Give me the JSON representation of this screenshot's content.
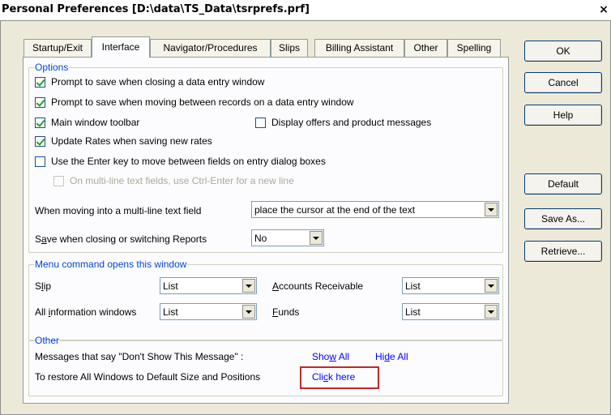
{
  "window": {
    "title": "Personal Preferences [D:\\data\\TS_Data\\tsrprefs.prf]",
    "close_label": "×"
  },
  "tabs": [
    {
      "label": "Startup/Exit",
      "active": false
    },
    {
      "label": "Interface",
      "active": true
    },
    {
      "label": "Navigator/Procedures",
      "active": false
    },
    {
      "label": "Slips",
      "active": false
    },
    {
      "label": "Billing Assistant",
      "active": false
    },
    {
      "label": "Other",
      "active": false
    },
    {
      "label": "Spelling",
      "active": false
    }
  ],
  "options": {
    "legend": "Options",
    "prompt_close": {
      "label": "Prompt to save when closing a data entry window",
      "checked": true
    },
    "prompt_move": {
      "label": "Prompt to save when moving between records on a data entry window",
      "checked": true
    },
    "main_toolbar": {
      "label": "Main window toolbar",
      "checked": true
    },
    "display_offers": {
      "label": "Display offers and product messages",
      "checked": false
    },
    "update_rates": {
      "label": "Update Rates when saving new rates",
      "checked": true
    },
    "enter_key": {
      "label": "Use the Enter key to move between fields on entry dialog boxes",
      "checked": false
    },
    "ctrl_enter": {
      "label": "On multi-line text fields, use Ctrl-Enter for a new line",
      "checked": false,
      "disabled": true
    },
    "multiline_label": "When moving into a multi-line text field",
    "multiline_value": "place the cursor at the end of the text",
    "save_switch_label_pre": "S",
    "save_switch_label_u": "a",
    "save_switch_label_post": "ve when closing or switching Reports",
    "save_switch_value": "No"
  },
  "menu_command": {
    "legend": "Menu command opens this window",
    "slip_label_pre": "S",
    "slip_label_u": "l",
    "slip_label_post": "ip",
    "slip_value": "List",
    "allinfo_label_pre": "All ",
    "allinfo_label_u": "i",
    "allinfo_label_post": "nformation windows",
    "allinfo_value": "List",
    "ar_label_pre": "",
    "ar_label_u": "A",
    "ar_label_post": "ccounts Receivable",
    "ar_value": "List",
    "funds_label_pre": "",
    "funds_label_u": "F",
    "funds_label_post": "unds",
    "funds_value": "List"
  },
  "other": {
    "legend": "Other",
    "dont_show_text": "Messages that say \"Don't Show This Message\" :",
    "show_all_pre": "Sho",
    "show_all_u": "w",
    "show_all_post": " All",
    "hide_all_pre": "Hi",
    "hide_all_u": "d",
    "hide_all_post": "e All",
    "restore_text": "To restore All Windows to Default Size and Positions",
    "click_here_pre": "Cli",
    "click_here_u": "c",
    "click_here_post": "k here"
  },
  "buttons": {
    "ok": "OK",
    "cancel": "Cancel",
    "help": "Help",
    "default": "Default",
    "save_as": "Save As...",
    "retrieve": "Retrieve..."
  },
  "colors": {
    "highlight_box": "#c0282e",
    "link": "#0000ff",
    "group_legend": "#0046d5"
  }
}
